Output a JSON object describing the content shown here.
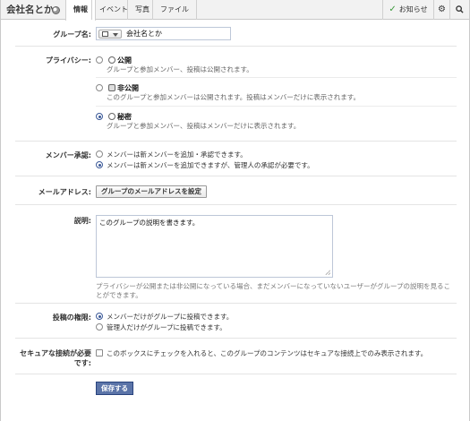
{
  "header": {
    "group_name": "会社名とか",
    "tabs": [
      "情報",
      "イベント",
      "写真",
      "ファイル"
    ],
    "notifications_label": "お知らせ"
  },
  "form": {
    "group_name": {
      "label": "グループ名:",
      "value": "会社名とか"
    },
    "privacy": {
      "label": "プライバシー:",
      "options": [
        {
          "title": "公開",
          "desc": "グループと参加メンバー、投稿は公開されます。",
          "selected": false
        },
        {
          "title": "非公開",
          "desc": "このグループと参加メンバーは公開されます。投稿はメンバーだけに表示されます。",
          "selected": false
        },
        {
          "title": "秘密",
          "desc": "グループと参加メンバー、投稿はメンバーだけに表示されます。",
          "selected": true
        }
      ]
    },
    "member_approval": {
      "label": "メンバー承認:",
      "options": [
        {
          "text": "メンバーは新メンバーを追加・承認できます。",
          "selected": false
        },
        {
          "text": "メンバーは新メンバーを追加できますが、管理人の承認が必要です。",
          "selected": true
        }
      ]
    },
    "email": {
      "label": "メールアドレス:",
      "button": "グループのメールアドレスを設定"
    },
    "description": {
      "label": "説明:",
      "value": "このグループの説明を書きます。",
      "hint": "プライバシーが公開または非公開になっている場合、まだメンバーになっていないユーザーがグループの説明を見ることができます。"
    },
    "posting": {
      "label": "投稿の権限:",
      "options": [
        {
          "text": "メンバーだけがグループに投稿できます。",
          "selected": true
        },
        {
          "text": "管理人だけがグループに投稿できます。",
          "selected": false
        }
      ]
    },
    "secure": {
      "label": "セキュアな接続が必要です:",
      "checkbox_text": "このボックスにチェックを入れると、このグループのコンテンツはセキュアな接続上でのみ表示されます。",
      "checked": false
    },
    "save_label": "保存する"
  }
}
